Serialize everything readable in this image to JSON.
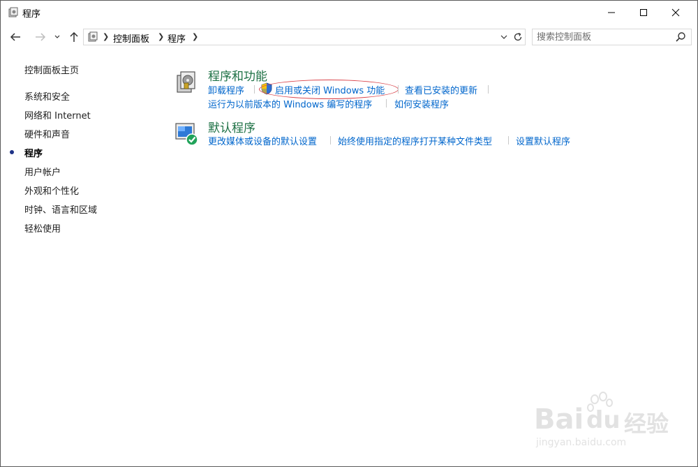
{
  "window": {
    "title": "程序"
  },
  "address": {
    "crumbs": [
      "控制面板",
      "程序"
    ]
  },
  "search": {
    "placeholder": "搜索控制面板"
  },
  "sidebar": {
    "home": "控制面板主页",
    "items": [
      {
        "label": "系统和安全",
        "current": false
      },
      {
        "label": "网络和 Internet",
        "current": false
      },
      {
        "label": "硬件和声音",
        "current": false
      },
      {
        "label": "程序",
        "current": true
      },
      {
        "label": "用户帐户",
        "current": false
      },
      {
        "label": "外观和个性化",
        "current": false
      },
      {
        "label": "时钟、语言和区域",
        "current": false
      },
      {
        "label": "轻松使用",
        "current": false
      }
    ]
  },
  "sections": {
    "programs": {
      "title": "程序和功能",
      "links": [
        "卸载程序",
        "启用或关闭 Windows 功能",
        "查看已安装的更新",
        "运行为以前版本的 Windows 编写的程序",
        "如何安装程序"
      ]
    },
    "defaults": {
      "title": "默认程序",
      "links": [
        "更改媒体或设备的默认设置",
        "始终使用指定的程序打开某种文件类型",
        "设置默认程序"
      ]
    }
  },
  "watermark": {
    "brand": "Bai",
    "brand2": "du",
    "cn": "经验",
    "url": "jingyan.baidu.com"
  },
  "colors": {
    "link": "#0066cc",
    "section_title": "#1e7145",
    "highlight": "#d9434a",
    "bullet": "#1e3287"
  }
}
